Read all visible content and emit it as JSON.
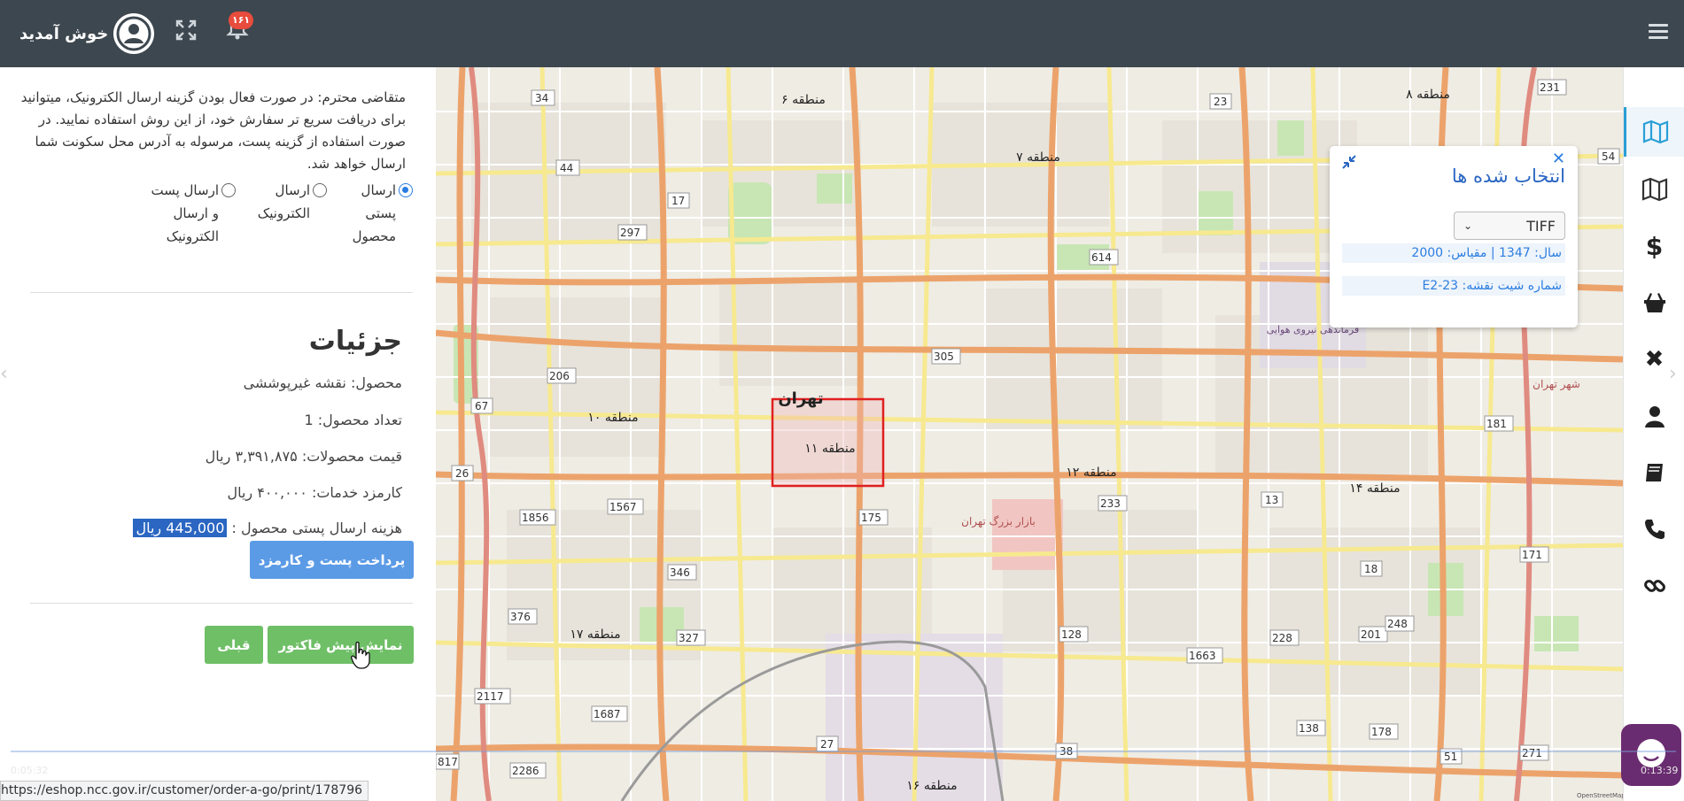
{
  "topbar": {
    "welcome": "خوش آمدید",
    "notification_count": "۱۶۱",
    "icons": [
      "user-avatar-icon",
      "expand-icon",
      "bell-icon",
      "hamburger-menu-icon"
    ]
  },
  "left_panel": {
    "notice": "متقاضی محترم: در صورت فعال بودن گزینه ارسال الکترونیک، میتوانید برای دریافت سریع تر سفارش خود، از این روش استفاده نمایید. در صورت استفاده از گزینه پست، مرسوله به آدرس محل سکونت شما ارسال خواهد شد.",
    "shipping_options": [
      {
        "label": "ارسال پستی محصول",
        "selected": true
      },
      {
        "label": "ارسال الکترونیک",
        "selected": false
      },
      {
        "label": "ارسال پست و ارسال الکترونیک",
        "selected": false
      }
    ],
    "details_title": "جزئیات",
    "product": "محصول: نقشه غیرپوششی",
    "quantity": "تعداد محصول: 1",
    "products_price": "قیمت محصولات: ۳,۳۹۱,۸۷۵ ریال",
    "service_fee": "کارمزد خدمات: ۴۰۰,۰۰۰ ریال",
    "postal_cost_label": "هزینه ارسال پستی محصول :",
    "postal_cost_value": "445,000 ریال",
    "pay_button": "پرداخت پست و کارمزد",
    "invoice_button": "نمایش پیش فاکتور",
    "prev_button": "قبلی"
  },
  "map": {
    "labels": [
      {
        "text": "تهران"
      },
      {
        "text": "منطقه ۶"
      },
      {
        "text": "منطقه ۷"
      },
      {
        "text": "منطقه ۸"
      },
      {
        "text": "منطقه ۱۰"
      },
      {
        "text": "منطقه ۱۱"
      },
      {
        "text": "منطقه ۱۲"
      },
      {
        "text": "منطقه ۱۴"
      },
      {
        "text": "منطقه ۱۶"
      },
      {
        "text": "منطقه ۱۷"
      },
      {
        "text": "بازار بزرگ تهران"
      },
      {
        "text": "فرماندهی نیروی هوایی"
      },
      {
        "text": "شهر تهران"
      }
    ],
    "road_numbers": [
      "34",
      "44",
      "17",
      "297",
      "206",
      "67",
      "26",
      "1567",
      "1856",
      "346",
      "376",
      "327",
      "2117",
      "1687",
      "2286",
      "27",
      "38",
      "128",
      "1663",
      "228",
      "201",
      "248",
      "171",
      "18",
      "13",
      "233",
      "181",
      "231",
      "23",
      "614",
      "305",
      "175",
      "138",
      "178",
      "51",
      "271",
      "54",
      "817"
    ],
    "attribution": "OpenStreetMap"
  },
  "popup": {
    "title": "انتخاب شده ها",
    "format": "TIFF",
    "year_scale": "سال: 1347 | مقیاس: 2000",
    "sheet_number": "شماره شیت نقشه: E2-23"
  },
  "right_sidebar": {
    "icons": [
      "map-icon",
      "map-outline-icon",
      "dollar-icon",
      "basket-icon",
      "close-icon",
      "user-icon",
      "book-icon",
      "phone-icon",
      "link-icon"
    ]
  },
  "status": {
    "url": "https://eshop.ncc.gov.ir/customer/order-a-go/print/178796",
    "time_elapsed": "0:05:32",
    "time_total": "0:13:39"
  },
  "colors": {
    "topbar": "#3d474f",
    "primary_blue": "#5b9be6",
    "success_green": "#6fbf67",
    "selection_red": "#e02020",
    "chat_purple": "#6a2c70"
  }
}
